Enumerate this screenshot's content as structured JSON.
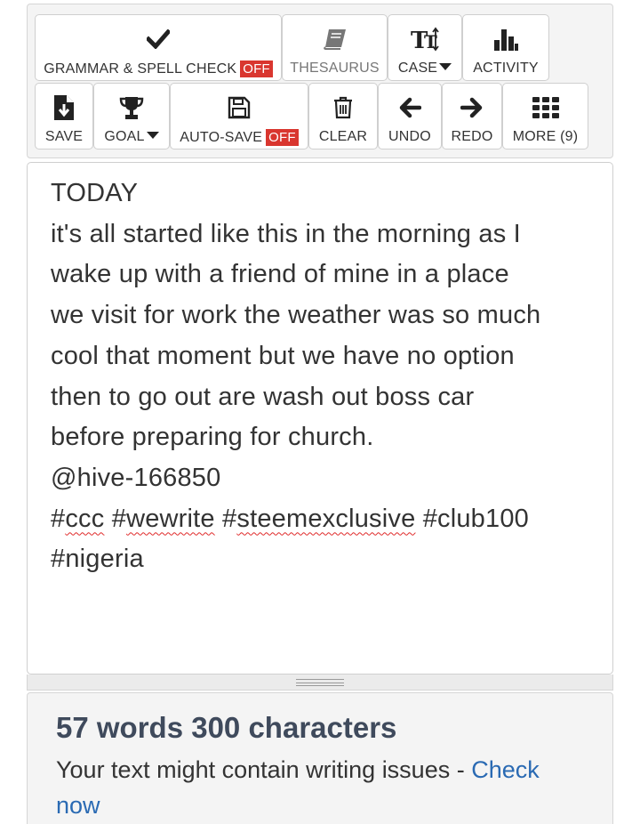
{
  "toolbar": {
    "row1": {
      "grammar": {
        "label": "GRAMMAR & SPELL CHECK",
        "state": "OFF",
        "icon": "check-icon"
      },
      "thesaurus": {
        "label": "THESAURUS",
        "icon": "book-icon"
      },
      "case": {
        "label": "CASE",
        "icon": "text-case-icon"
      },
      "activity": {
        "label": "ACTIVITY",
        "icon": "bar-chart-icon"
      }
    },
    "row2": {
      "save": {
        "label": "SAVE",
        "icon": "file-download-icon"
      },
      "goal": {
        "label": "GOAL",
        "icon": "trophy-icon"
      },
      "autosave": {
        "label": "AUTO-SAVE",
        "state": "OFF",
        "icon": "floppy-disk-icon"
      },
      "clear": {
        "label": "CLEAR",
        "icon": "trash-icon"
      },
      "undo": {
        "label": "UNDO",
        "icon": "arrow-left-icon"
      },
      "redo": {
        "label": "REDO",
        "icon": "arrow-right-icon"
      },
      "more": {
        "label": "MORE (9)",
        "icon": "grid-icon"
      }
    }
  },
  "editor": {
    "lines": [
      "TODAY",
      "it's all started like this in the morning as I",
      "wake up with a friend of mine in a place",
      "we visit for work the weather was so much",
      "cool that moment but we have no option",
      "then to go out are wash out boss car",
      "before preparing for church.",
      "@hive-166850"
    ],
    "tags": [
      "#ccc",
      "#wewrite",
      "#steemexclusive",
      "#club100",
      "#nigeria"
    ]
  },
  "stats": {
    "count": "57 words 300 characters",
    "message": "Your text might contain writing issues - ",
    "link": "Check now"
  },
  "colors": {
    "badge": "#d9362f",
    "link": "#2a6ab3",
    "count": "#3f4a5c"
  }
}
